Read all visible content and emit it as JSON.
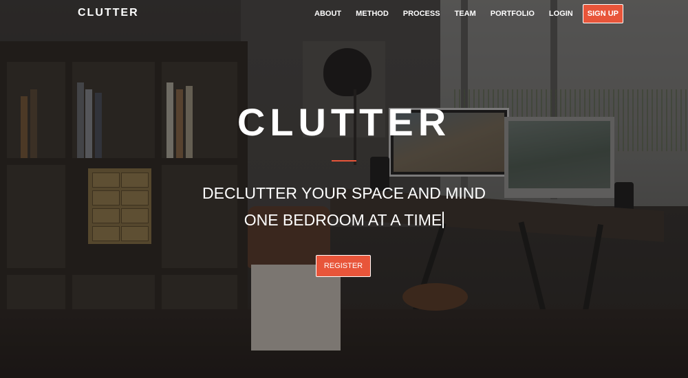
{
  "navbar": {
    "brand": "CLUTTER",
    "links": [
      "ABOUT",
      "METHOD",
      "PROCESS",
      "TEAM",
      "PORTFOLIO",
      "LOGIN"
    ],
    "signup_label": "SIGN UP"
  },
  "hero": {
    "title": "CLUTTER",
    "tagline_line1": "DECLUTTER YOUR SPACE AND MIND",
    "tagline_line2": "ONE BEDROOM AT A TIME",
    "cta_label": "REGISTER"
  },
  "colors": {
    "accent": "#e8553a",
    "text": "#ffffff"
  }
}
